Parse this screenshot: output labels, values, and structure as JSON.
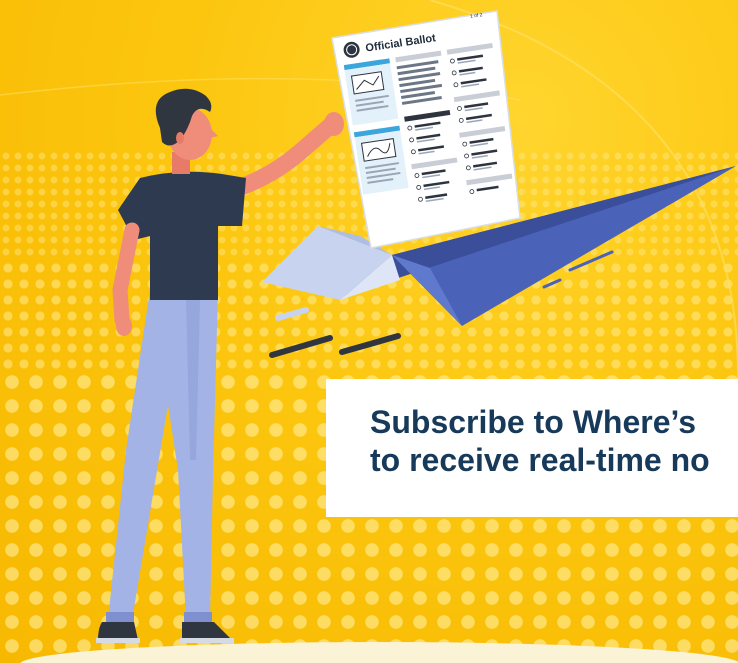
{
  "ballot": {
    "title": "Official Ballot",
    "page_label": "1 of 2"
  },
  "banner": {
    "line1": "Subscribe to Where’s",
    "line2": "to receive real-time no"
  },
  "colors": {
    "background": "#fcc60f",
    "banner_text": "#183a5a",
    "plane_blue": "#4a62b8"
  }
}
